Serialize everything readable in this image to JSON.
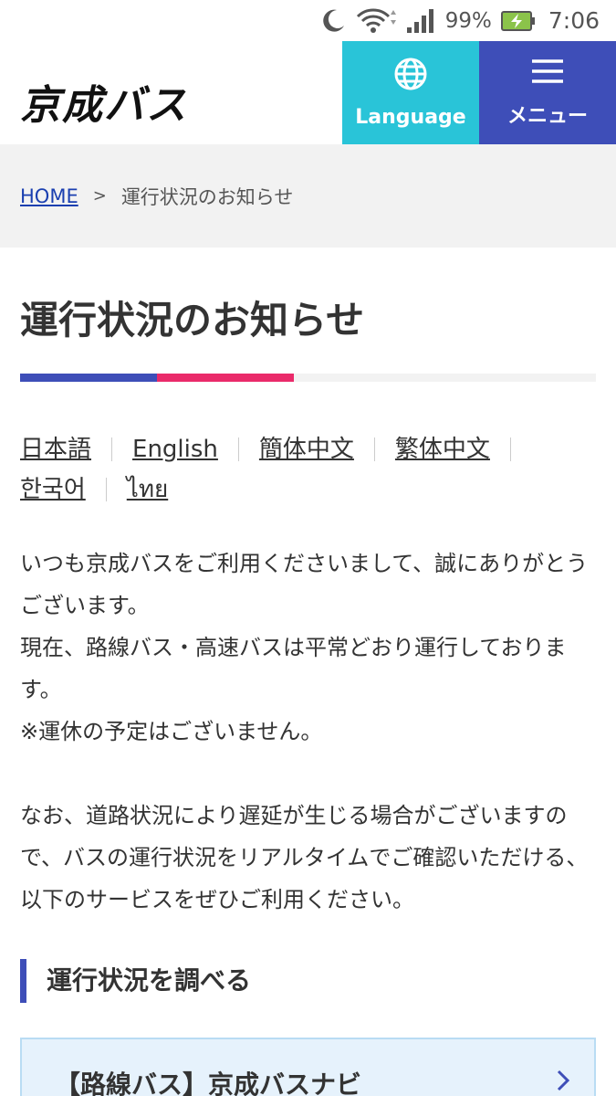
{
  "status_bar": {
    "battery_percent": "99%",
    "time": "7:06",
    "icons": [
      "moon-icon",
      "wifi-icon",
      "signal-icon",
      "battery-charging-icon"
    ]
  },
  "header": {
    "logo_text": "京成バス",
    "language_label": "Language",
    "menu_label": "メニュー",
    "colors": {
      "language_bg": "#29c4d8",
      "menu_bg": "#3e4eb8"
    }
  },
  "breadcrumb": {
    "home": "HOME",
    "separator": ">",
    "current": "運行状況のお知らせ"
  },
  "page": {
    "title": "運行状況のお知らせ",
    "accent_colors": [
      "#3e4eb8",
      "#ea2a6a",
      "#f2f2f2"
    ]
  },
  "languages": [
    "日本語",
    "English",
    "簡体中文",
    "繁体中文",
    "한국어",
    "ไทย"
  ],
  "notice": {
    "line1": "いつも京成バスをご利用くださいまして、誠にありがとうございます。",
    "line2": "現在、路線バス・高速バスは平常どおり運行しております。",
    "line3": "※運休の予定はございません。",
    "line4": "なお、道路状況により遅延が生じる場合がございますので、バスの運行状況をリアルタイムでご確認いただける、以下のサービスをぜひご利用ください。"
  },
  "section": {
    "heading": "運行状況を調べる",
    "card_label": "【路線バス】京成バスナビ"
  }
}
